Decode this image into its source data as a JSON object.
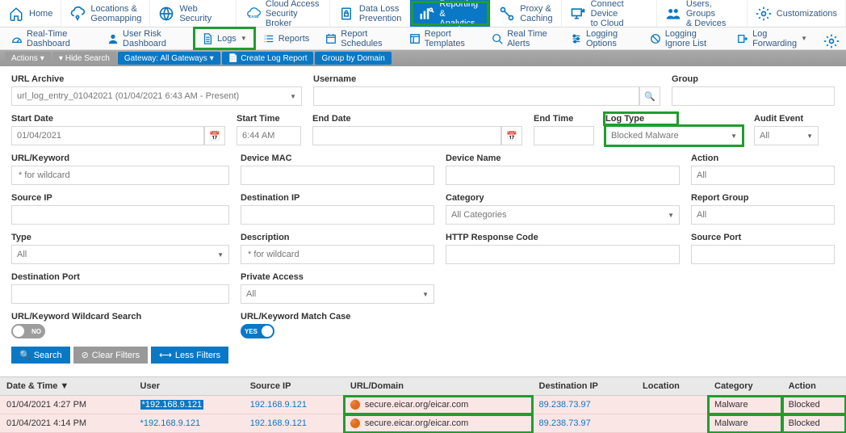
{
  "topnav": [
    {
      "label": "Home",
      "icon": "home"
    },
    {
      "label": "Locations &\nGeomapping",
      "icon": "cloud-pin"
    },
    {
      "label": "Web Security",
      "icon": "globe"
    },
    {
      "label": "Cloud Access\nSecurity Broker",
      "icon": "casb"
    },
    {
      "label": "Data Loss\nPrevention",
      "icon": "lock-doc"
    },
    {
      "label": "Reporting &\nAnalytics",
      "icon": "bars",
      "active": true,
      "highlight": true
    },
    {
      "label": "Proxy &\nCaching",
      "icon": "proxy"
    },
    {
      "label": "Connect Device\nto Cloud",
      "icon": "device"
    },
    {
      "label": "Users, Groups\n& Devices",
      "icon": "users"
    },
    {
      "label": "Customizations",
      "icon": "gear"
    }
  ],
  "subnav": [
    {
      "label": "Real-Time Dashboard",
      "icon": "dash"
    },
    {
      "label": "User Risk Dashboard",
      "icon": "user-risk"
    },
    {
      "label": "Logs",
      "icon": "doc",
      "caret": true,
      "highlight": true
    },
    {
      "label": "Reports",
      "icon": "list"
    },
    {
      "label": "Report Schedules",
      "icon": "calendar"
    },
    {
      "label": "Report Templates",
      "icon": "template"
    },
    {
      "label": "Real Time Alerts",
      "icon": "alert"
    },
    {
      "label": "Logging Options",
      "icon": "options"
    },
    {
      "label": "Logging Ignore List",
      "icon": "ignore"
    },
    {
      "label": "Log Forwarding",
      "icon": "forward",
      "caret": true
    }
  ],
  "toolbar": {
    "actions": "Actions",
    "hide": "Hide Search",
    "gateway": "Gateway: All Gateways",
    "create": "Create Log Report",
    "group": "Group by Domain"
  },
  "fields": {
    "url_archive": {
      "label": "URL Archive",
      "value": "url_log_entry_01042021 (01/04/2021 6:43 AM - Present)"
    },
    "username": {
      "label": "Username",
      "value": ""
    },
    "group": {
      "label": "Group",
      "value": ""
    },
    "start_date": {
      "label": "Start Date",
      "value": "01/04/2021"
    },
    "start_time": {
      "label": "Start Time",
      "value": "6:44 AM"
    },
    "end_date": {
      "label": "End Date",
      "value": ""
    },
    "end_time": {
      "label": "End Time",
      "value": ""
    },
    "log_type": {
      "label": "Log Type",
      "value": "Blocked Malware"
    },
    "audit_event": {
      "label": "Audit Event",
      "value": "All"
    },
    "url_keyword": {
      "label": "URL/Keyword",
      "placeholder": "* for wildcard"
    },
    "device_mac": {
      "label": "Device MAC",
      "value": ""
    },
    "device_name": {
      "label": "Device Name",
      "value": ""
    },
    "action": {
      "label": "Action",
      "value": "All"
    },
    "source_ip": {
      "label": "Source IP",
      "value": ""
    },
    "dest_ip": {
      "label": "Destination IP",
      "value": ""
    },
    "category": {
      "label": "Category",
      "value": "All Categories"
    },
    "report_group": {
      "label": "Report Group",
      "value": "All"
    },
    "type": {
      "label": "Type",
      "value": "All"
    },
    "description": {
      "label": "Description",
      "placeholder": "* for wildcard"
    },
    "http_code": {
      "label": "HTTP Response Code",
      "value": ""
    },
    "source_port": {
      "label": "Source Port",
      "value": ""
    },
    "dest_port": {
      "label": "Destination Port",
      "value": ""
    },
    "private_access": {
      "label": "Private Access",
      "value": "All"
    },
    "wildcard": {
      "label": "URL/Keyword Wildcard Search",
      "toggle": "NO"
    },
    "match_case": {
      "label": "URL/Keyword Match Case",
      "toggle": "YES"
    }
  },
  "buttons": {
    "search": "Search",
    "clear": "Clear Filters",
    "less": "Less Filters"
  },
  "table": {
    "headers": [
      "Date & Time",
      "User",
      "Source IP",
      "URL/Domain",
      "Destination IP",
      "Location",
      "Category",
      "Action"
    ],
    "rows": [
      {
        "dt": "01/04/2021 4:27 PM",
        "user": "*192.168.9.121",
        "user_sel": true,
        "sip": "192.168.9.121",
        "url": "secure.eicar.org/eicar.com",
        "dip": "89.238.73.97",
        "loc": "",
        "cat": "Malware",
        "act": "Blocked"
      },
      {
        "dt": "01/04/2021 4:14 PM",
        "user": "*192.168.9.121",
        "sip": "192.168.9.121",
        "url": "secure.eicar.org/eicar.com",
        "dip": "89.238.73.97",
        "loc": "",
        "cat": "Malware",
        "act": "Blocked"
      }
    ]
  }
}
